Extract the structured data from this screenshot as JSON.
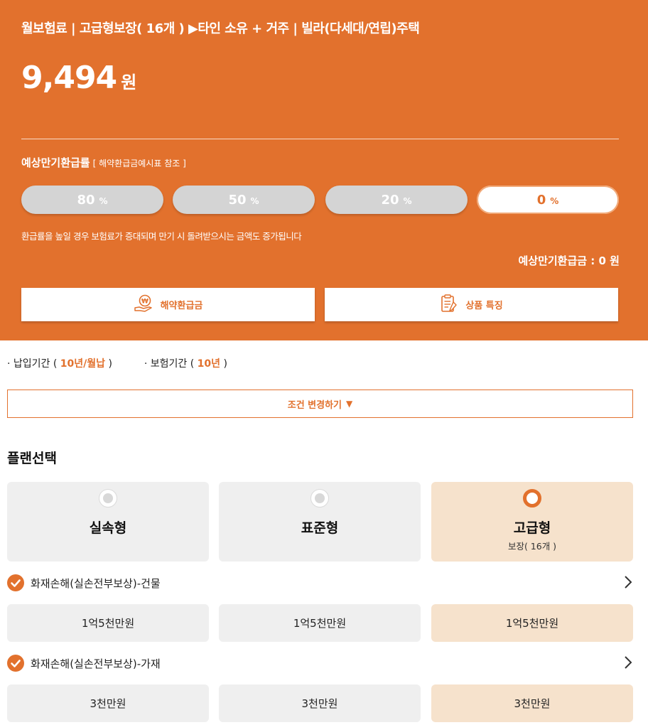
{
  "header": {
    "title": "월보험료 | 고급형보장( 16개 ) ▶타인 소유 + 거주 | 빌라(다세대/연립)주택",
    "premium_amount": "9,494",
    "premium_unit": "원",
    "refund_rate_label": "예상만기환급률",
    "refund_rate_ref": "[ 해약환급금예시표 참조 ]",
    "rate_options": [
      {
        "value": "80",
        "unit": "%",
        "selected": false
      },
      {
        "value": "50",
        "unit": "%",
        "selected": false
      },
      {
        "value": "20",
        "unit": "%",
        "selected": false
      },
      {
        "value": "0",
        "unit": "%",
        "selected": true
      }
    ],
    "note": "환급률을 높일 경우 보험료가 증대되며 만기 시 돌려받으시는 금액도 증가됩니다",
    "expected_refund": "예상만기환급금 : 0 원",
    "buttons": {
      "surrender_refund": "해약환급금",
      "product_features": "상품 특징"
    }
  },
  "terms": {
    "payment_label": "· 납입기간 (",
    "payment_value": "10년/월납",
    "payment_close": ")",
    "coverage_label": "· 보험기간 (",
    "coverage_value": "10년",
    "coverage_close": ")"
  },
  "change_conditions_label": "조건 변경하기",
  "plan_section": {
    "title": "플랜선택",
    "plans": [
      {
        "name": "실속형",
        "sub": "",
        "selected": false
      },
      {
        "name": "표준형",
        "sub": "",
        "selected": false
      },
      {
        "name": "고급형",
        "sub": "보장( 16개 )",
        "selected": true
      }
    ]
  },
  "coverages": [
    {
      "label": "화재손해(실손전부보상)-건물",
      "values": [
        "1억5천만원",
        "1억5천만원",
        "1억5천만원"
      ]
    },
    {
      "label": "화재손해(실손전부보상)-가재",
      "values": [
        "3천만원",
        "3천만원",
        "3천만원"
      ]
    }
  ],
  "colors": {
    "accent": "#e2712d",
    "selected_bg": "#f6e2cc",
    "card_bg": "#efefef"
  }
}
